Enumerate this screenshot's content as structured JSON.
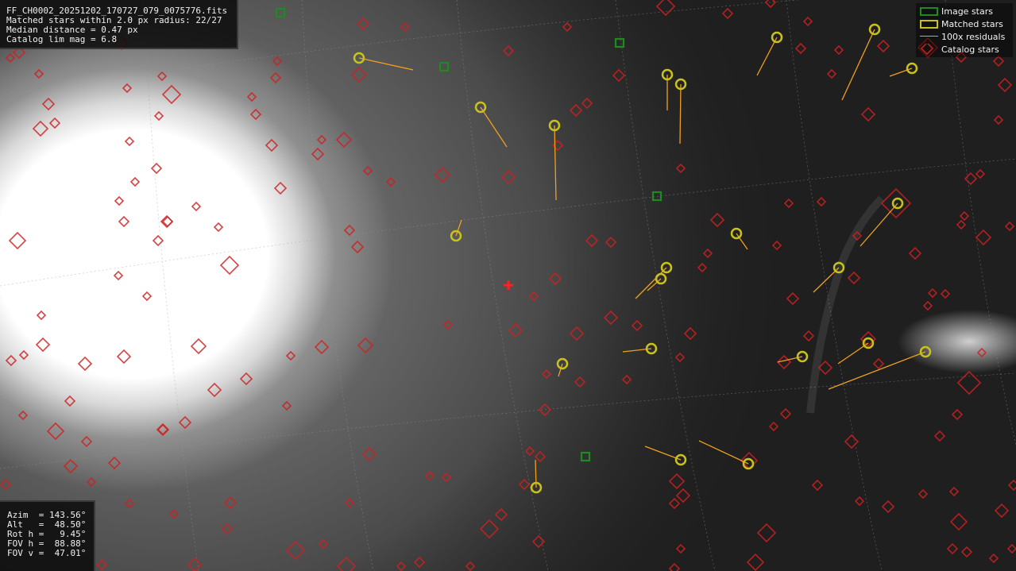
{
  "info_panel": {
    "filename": "FF_CH0002_20251202_170727_079_0075776.fits",
    "matched": "Matched stars within 2.0 px radius: 22/27",
    "median": "Median distance = 0.47 px",
    "limmag": "Catalog lim mag = 6.8"
  },
  "pointing_panel": {
    "azim": "Azim  = 143.56°",
    "alt": "Alt   =  48.50°",
    "rot": "Rot h =   9.45°",
    "fovh": "FOV h =  88.88°",
    "fovv": "FOV v =  47.01°"
  },
  "legend": {
    "image_stars": "Image stars",
    "matched_stars": "Matched stars",
    "residuals": "100x residuals",
    "catalog_stars": "Catalog stars"
  },
  "colors": {
    "catalog": "#d02020",
    "matched": "#c9c21c",
    "image": "#1f8a1f",
    "residual": "#f0a020",
    "center": "#ff2020"
  }
}
